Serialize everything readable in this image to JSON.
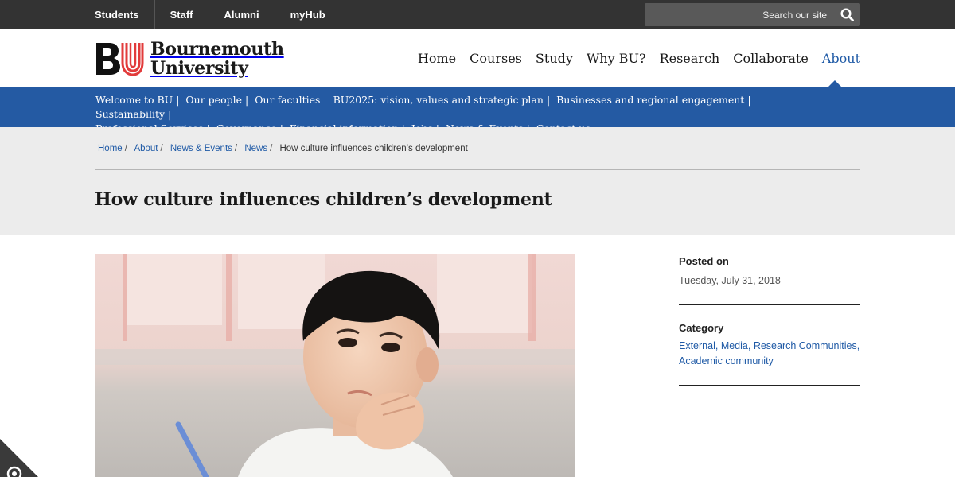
{
  "topbar": {
    "links": [
      "Students",
      "Staff",
      "Alumni",
      "myHub"
    ],
    "search_placeholder": "Search our site",
    "search_icon": "search-icon"
  },
  "header": {
    "logo_mark": "BU",
    "logo_line1": "Bournemouth",
    "logo_line2": "University",
    "nav": [
      "Home",
      "Courses",
      "Study",
      "Why BU?",
      "Research",
      "Collaborate",
      "About"
    ],
    "active_nav": "About"
  },
  "subnav": {
    "items": [
      "Welcome to BU",
      "Our people",
      "Our faculties",
      "BU2025: vision, values and strategic plan",
      "Businesses and regional engagement",
      "Sustainability",
      "Professional Services",
      "Governance",
      "Financial information",
      "Jobs",
      "News & Events",
      "Contact us"
    ],
    "current": "News & Events"
  },
  "breadcrumb": {
    "items": [
      "Home",
      "About",
      "News & Events",
      "News"
    ],
    "current": "How culture influences children’s development"
  },
  "page": {
    "title": "How culture influences children’s development"
  },
  "sidebar": {
    "posted_label": "Posted on",
    "posted_value": "Tuesday, July 31, 2018",
    "category_label": "Category",
    "categories": [
      "External",
      "Media",
      "Research Communities",
      "Academic community"
    ]
  },
  "colors": {
    "topbar": "#333333",
    "brand_blue": "#245aa3",
    "link_blue": "#1f5aa6",
    "band_grey": "#ececec",
    "logo_red": "#e23b3b"
  }
}
